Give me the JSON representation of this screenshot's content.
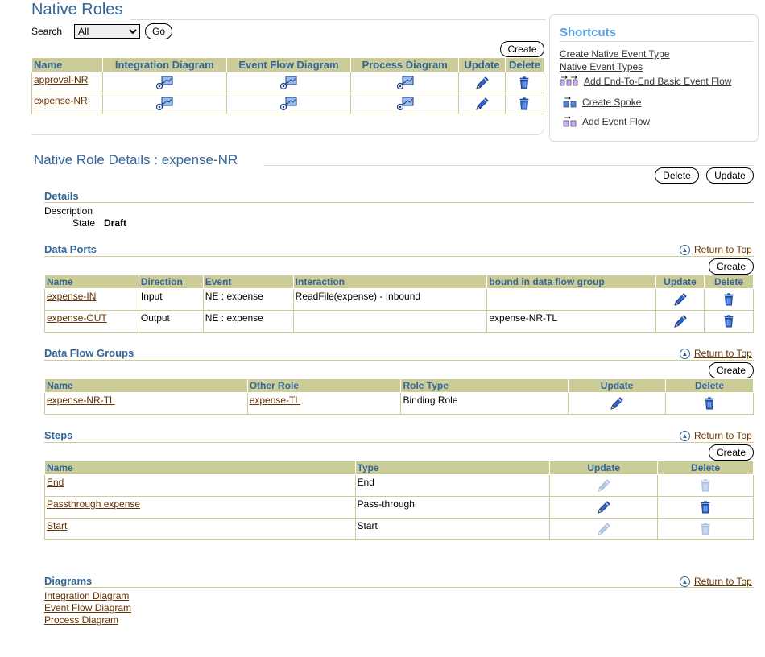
{
  "native_roles": {
    "title": "Native Roles",
    "search_label": "Search",
    "search_value": "All",
    "go_label": "Go",
    "create_label": "Create",
    "columns": [
      "Name",
      "Integration Diagram",
      "Event Flow Diagram",
      "Process Diagram",
      "Update",
      "Delete"
    ],
    "rows": [
      {
        "name": "approval-NR"
      },
      {
        "name": "expense-NR"
      }
    ]
  },
  "shortcuts": {
    "title": "Shortcuts",
    "items": [
      "Create Native Event Type",
      "Native Event Types",
      "Add End-To-End Basic Event Flow",
      "Create Spoke",
      "Add Event Flow"
    ]
  },
  "details_page": {
    "title": "Native Role Details : expense-NR",
    "delete_label": "Delete",
    "update_label": "Update",
    "return_to_top": "Return to Top",
    "create_label": "Create"
  },
  "details": {
    "heading": "Details",
    "description_label": "Description",
    "state_label": "State",
    "state_value": "Draft"
  },
  "data_ports": {
    "heading": "Data Ports",
    "columns": [
      "Name",
      "Direction",
      "Event",
      "Interaction",
      "bound in data flow group",
      "Update",
      "Delete"
    ],
    "rows": [
      {
        "name": "expense-IN",
        "direction": "Input",
        "event": "NE : expense",
        "interaction": "ReadFile(expense) - Inbound",
        "group": ""
      },
      {
        "name": "expense-OUT",
        "direction": "Output",
        "event": "NE : expense",
        "interaction": "",
        "group": "expense-NR-TL"
      }
    ]
  },
  "data_flow_groups": {
    "heading": "Data Flow Groups",
    "columns": [
      "Name",
      "Other Role",
      "Role Type",
      "Update",
      "Delete"
    ],
    "rows": [
      {
        "name": "expense-NR-TL",
        "other_role": "expense-TL",
        "role_type": "Binding Role"
      }
    ]
  },
  "steps": {
    "heading": "Steps",
    "columns": [
      "Name",
      "Type",
      "Update",
      "Delete"
    ],
    "rows": [
      {
        "name": "End",
        "type": "End"
      },
      {
        "name": "Passthrough expense",
        "type": "Pass-through"
      },
      {
        "name": "Start",
        "type": "Start"
      }
    ]
  },
  "diagrams": {
    "heading": "Diagrams",
    "links": [
      "Integration Diagram",
      "Event Flow Diagram",
      "Process Diagram"
    ]
  },
  "colors": {
    "heading_blue": "#336699",
    "table_header": "#cccc99",
    "link": "#663300"
  }
}
